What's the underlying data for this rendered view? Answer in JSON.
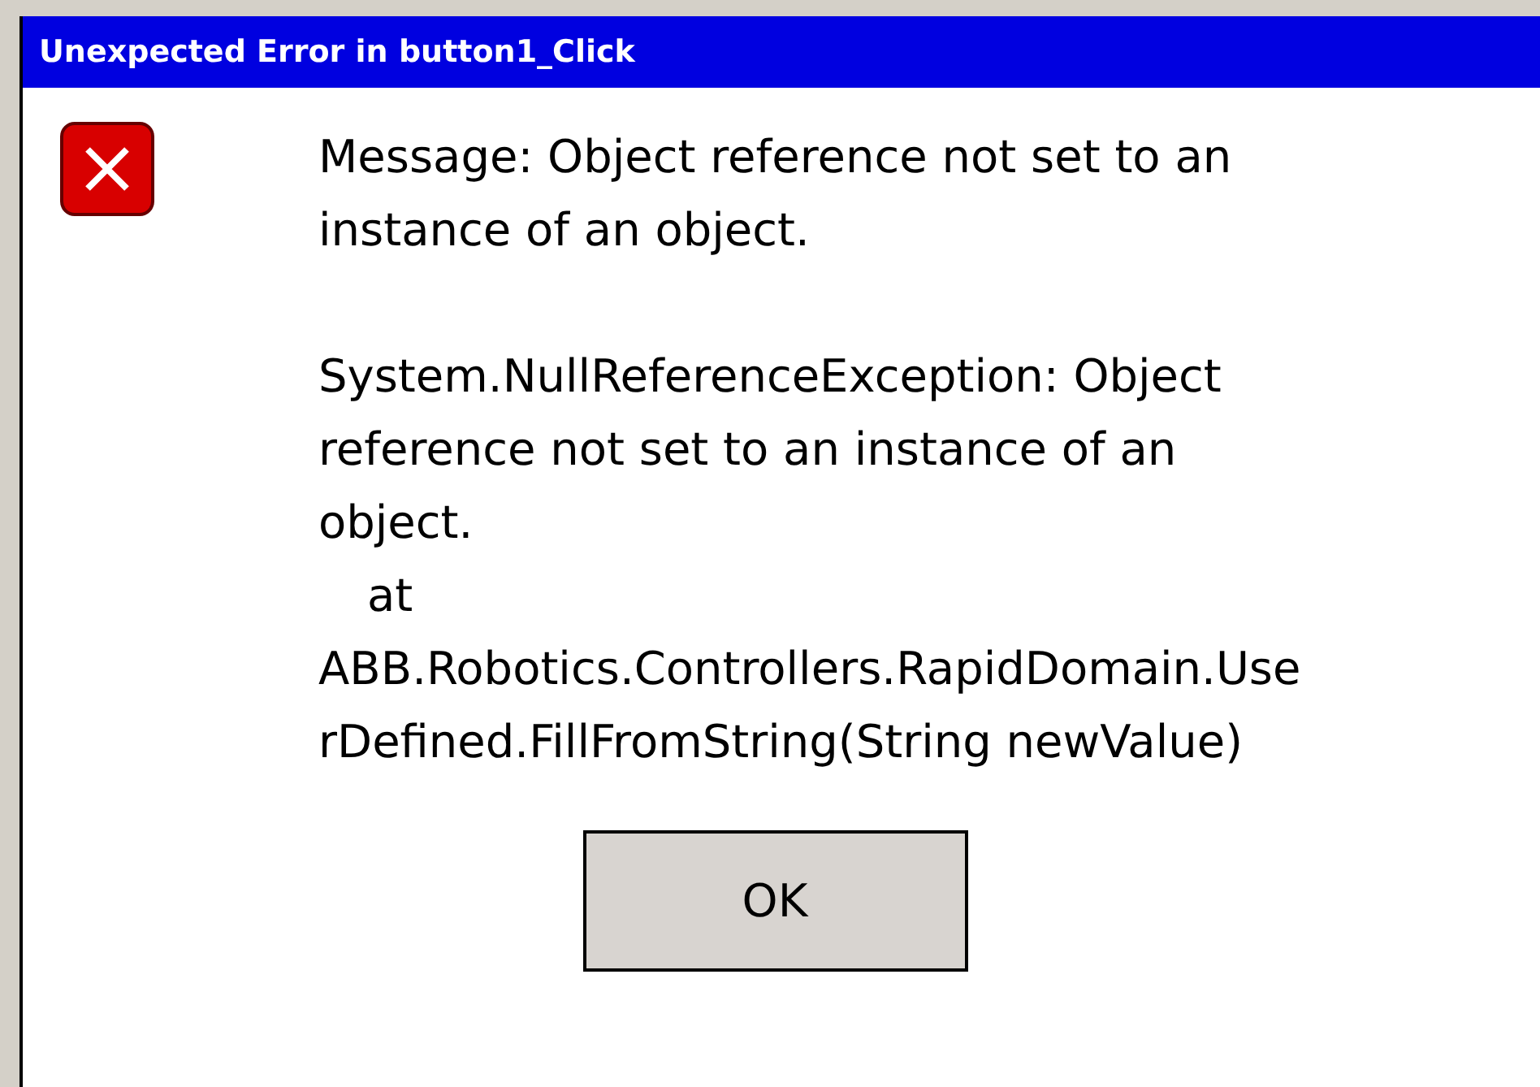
{
  "window": {
    "title": "Unexpected Error in button1_Click"
  },
  "message": {
    "paragraphs": [
      {
        "lines": [
          {
            "text": "Message: Object reference not set to an",
            "indent": false
          },
          {
            "text": "instance of an object.",
            "indent": false
          }
        ]
      },
      {
        "lines": [
          {
            "text": "System.NullReferenceException: Object",
            "indent": false
          },
          {
            "text": "reference not set to an instance of an",
            "indent": false
          },
          {
            "text": "object.",
            "indent": false
          },
          {
            "text": "at",
            "indent": true
          },
          {
            "text": "ABB.Robotics.Controllers.RapidDomain.Use",
            "indent": false
          },
          {
            "text": "rDefined.FillFromString(String newValue)",
            "indent": false
          }
        ]
      }
    ]
  },
  "buttons": [
    {
      "label": "OK"
    }
  ]
}
